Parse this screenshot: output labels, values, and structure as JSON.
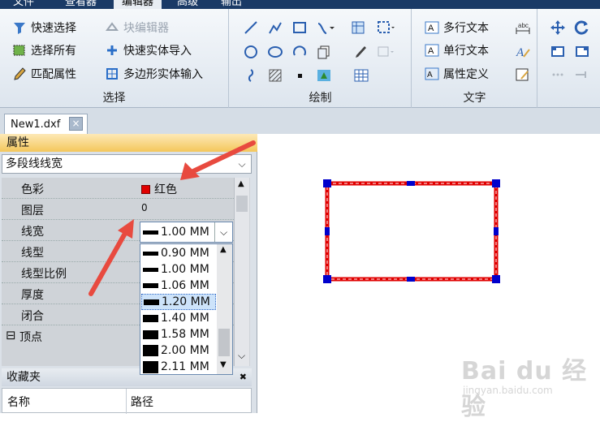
{
  "menubar": {
    "items": [
      {
        "label": "文件"
      },
      {
        "label": "查看器"
      },
      {
        "label": "编辑器",
        "active": true
      },
      {
        "label": "高级"
      },
      {
        "label": "输出"
      }
    ]
  },
  "ribbon": {
    "select_group": {
      "label": "选择",
      "quick_select": "快速选择",
      "block_editor": "块编辑器",
      "select_all": "选择所有",
      "quick_solid_import": "快速实体导入",
      "match_properties": "匹配属性",
      "polygon_solid_input": "多边形实体输入"
    },
    "draw_group": {
      "label": "绘制"
    },
    "text_group": {
      "label": "文字",
      "mtext": "多行文本",
      "text": "单行文本",
      "attdef": "属性定义"
    }
  },
  "document_tab": {
    "title": "New1.dxf",
    "close": "×"
  },
  "properties_panel": {
    "title": "属性",
    "pin": "✖",
    "object_type": "多段线线宽",
    "rows": [
      {
        "name": "色彩",
        "value": "红色"
      },
      {
        "name": "图层",
        "value": "0"
      },
      {
        "name": "线宽",
        "value": "1.00 MM"
      },
      {
        "name": "线型",
        "value": ""
      },
      {
        "name": "线型比例",
        "value": ""
      },
      {
        "name": "厚度",
        "value": ""
      },
      {
        "name": "闭合",
        "value": ""
      },
      {
        "name": "顶点",
        "value": "",
        "expander": "⊟"
      }
    ],
    "lineweight_options": [
      "0.90 MM",
      "1.00 MM",
      "1.06 MM",
      "1.20 MM",
      "1.40 MM",
      "1.58 MM",
      "2.00 MM",
      "2.11 MM"
    ],
    "lineweight_selected": "1.20 MM"
  },
  "favorites_panel": {
    "title": "收藏夹",
    "pin": "✖",
    "col_name": "名称",
    "col_path": "路径"
  },
  "watermark": {
    "brand": "Bai du 经验",
    "url": "jingyan.baidu.com"
  },
  "colors": {
    "accent": "#1a3a66",
    "selection_red": "#e00000",
    "grip_blue": "#0000cc",
    "panel_header": "#f4c75c"
  }
}
